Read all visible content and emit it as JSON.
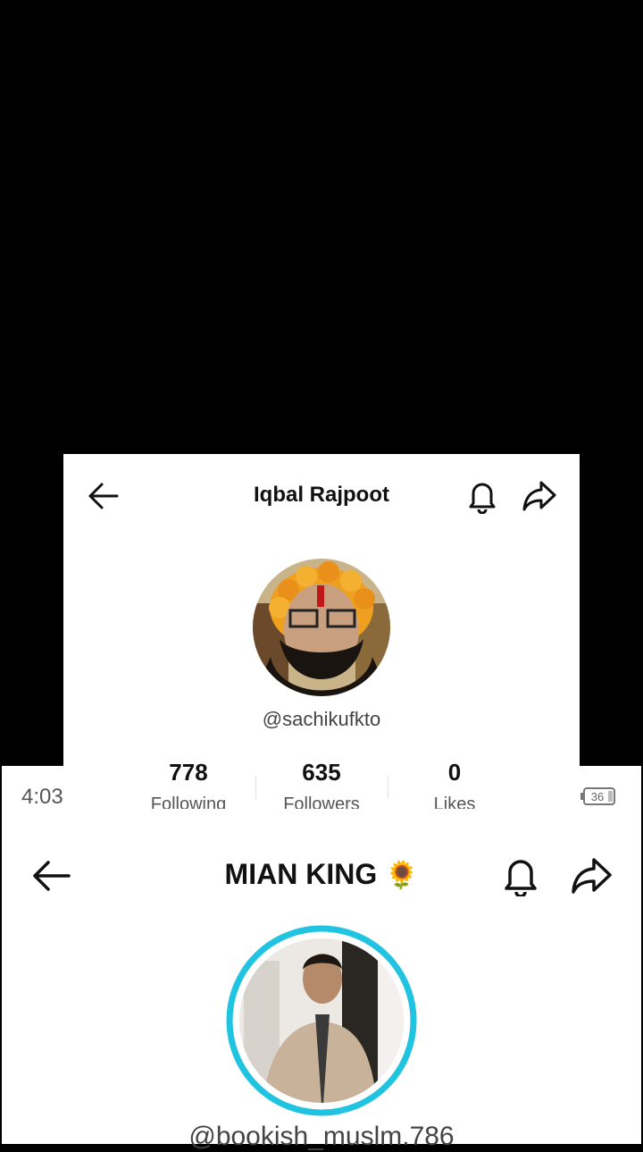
{
  "profile_top": {
    "name": "Iqbal Rajpoot",
    "username": "@sachikufkto",
    "stats": [
      {
        "value": "778",
        "label": "Following"
      },
      {
        "value": "635",
        "label": "Followers"
      },
      {
        "value": "0",
        "label": "Likes"
      }
    ],
    "icons": [
      "back-arrow-icon",
      "bell-icon",
      "share-icon"
    ]
  },
  "status_bar": {
    "time": "4:03",
    "battery": "36"
  },
  "profile_bottom": {
    "name": "MIAN KING",
    "name_emoji": "🌻",
    "username": "@bookish_muslm.786",
    "avatar_ring_color": "#20c4e0",
    "icons": [
      "back-arrow-icon",
      "bell-icon",
      "share-icon"
    ]
  }
}
